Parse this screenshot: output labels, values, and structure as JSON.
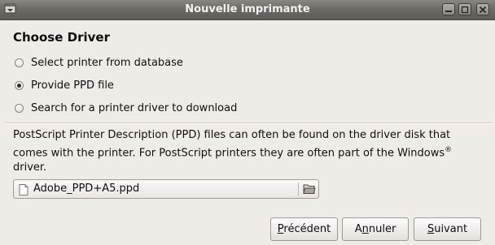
{
  "window": {
    "title": "Nouvelle imprimante"
  },
  "page": {
    "heading": "Choose Driver"
  },
  "options": [
    {
      "label": "Select printer from database",
      "checked": false
    },
    {
      "label": "Provide PPD file",
      "checked": true
    },
    {
      "label": "Search for a printer driver to download",
      "checked": false
    }
  ],
  "description": {
    "line1": "PostScript Printer Description (PPD) files can often be found on the driver disk that",
    "line2": "comes with the printer. For PostScript printers they are often part of the Windows",
    "superscript": "®",
    "line3": "driver."
  },
  "file_chooser": {
    "value": "Adobe_PPD+A5.ppd"
  },
  "buttons": {
    "previous": {
      "mnemonic": "P",
      "rest": "récédent"
    },
    "cancel": {
      "first": "A",
      "mnemonic": "n",
      "rest": "nuler"
    },
    "next": {
      "mnemonic": "S",
      "rest": "uivant"
    }
  },
  "icons": {
    "window_menu": "window-menu-icon",
    "minimize": "minimize-icon",
    "maximize": "maximize-icon",
    "close": "close-icon",
    "file": "file-icon",
    "folder": "folder-open-icon"
  }
}
